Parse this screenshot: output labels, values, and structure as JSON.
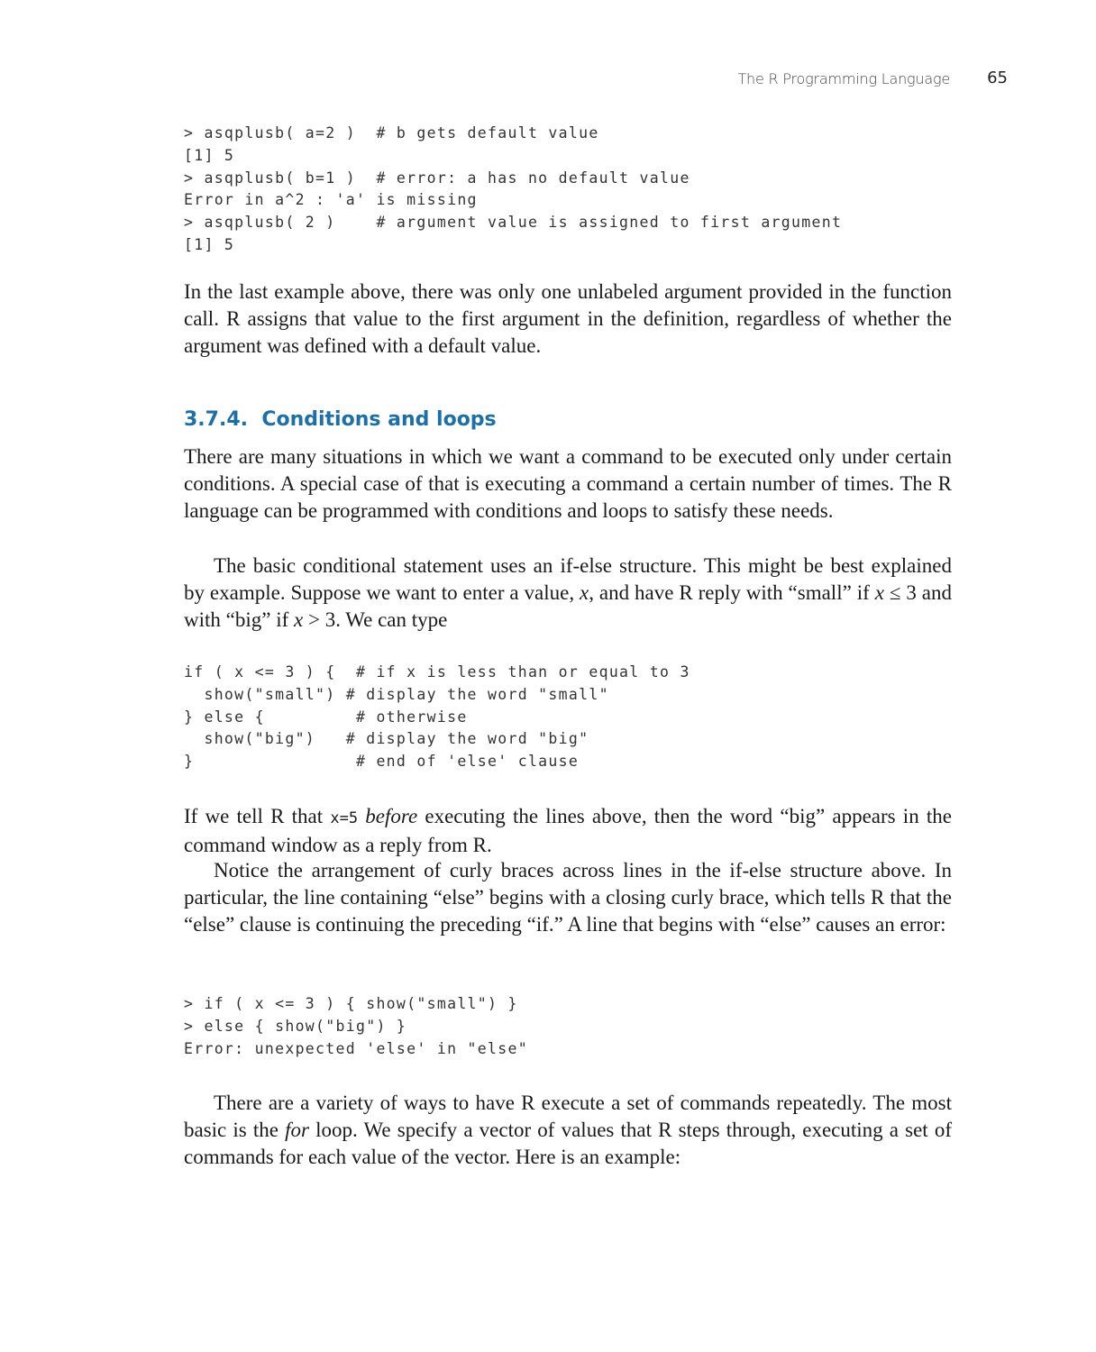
{
  "header": {
    "running_title": "The R Programming Language",
    "page_number": "65"
  },
  "code_block_1": {
    "lines": [
      "> asqplusb( a=2 )  # b gets default value",
      "[1] 5",
      "> asqplusb( b=1 )  # error: a has no default value",
      "Error in a^2 : 'a' is missing",
      "> asqplusb( 2 )    # argument value is assigned to first argument",
      "[1] 5"
    ]
  },
  "paragraph_1": {
    "text": "In the last example above, there was only one unlabeled argument provided in the function call. R assigns that value to the first argument in the definition, regardless of whether the argument was defined with a default value."
  },
  "section_heading": {
    "number": "3.7.4.",
    "title": "Conditions and loops"
  },
  "paragraph_2": {
    "text": "There are many situations in which we want a command to be executed only under certain conditions. A special case of that is executing a command a certain number of times. The R language can be programmed with conditions and loops to satisfy these needs."
  },
  "paragraph_3": {
    "part1": "The basic conditional statement uses an if-else structure. This might be best explained by example. Suppose we want to enter a value, ",
    "x1": "x",
    "part2": ", and have R reply with “small” if ",
    "x2": "x",
    "part3": " ≤ 3 and with “big” if ",
    "x3": "x",
    "part4": " > 3. We can type"
  },
  "code_block_2": {
    "lines": [
      "if ( x <= 3 ) {  # if x is less than or equal to 3",
      "  show(\"small\") # display the word \"small\"",
      "} else {         # otherwise",
      "  show(\"big\")   # display the word \"big\"",
      "}                # end of 'else' clause"
    ]
  },
  "paragraph_4": {
    "part1": "If we tell R that ",
    "code": "x=5",
    "space": " ",
    "emphasis": "before",
    "part2": " executing the lines above, then the word “big” appears in the command window as a reply from R."
  },
  "paragraph_5": {
    "text": "Notice the arrangement of curly braces across lines in the if-else structure above. In particular, the line containing “else” begins with a closing curly brace, which tells R that the “else” clause is continuing the preceding “if.” A line that begins with “else” causes an error:"
  },
  "code_block_3": {
    "lines": [
      "> if ( x <= 3 ) { show(\"small\") }",
      "> else { show(\"big\") }",
      "Error: unexpected 'else' in \"else\""
    ]
  },
  "paragraph_6": {
    "part1": "There are a variety of ways to have R execute a set of commands repeatedly. The most basic is the ",
    "emphasis": "for",
    "part2": " loop. We specify a vector of values that R steps through, executing a set of commands for each value of the vector. Here is an example:"
  }
}
